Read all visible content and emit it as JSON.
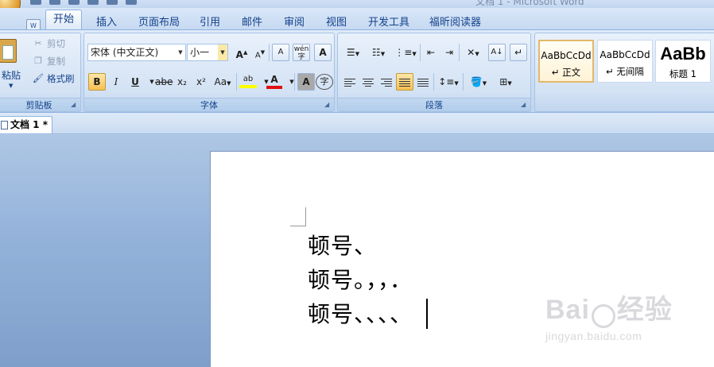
{
  "window": {
    "title": "文档 1 - Microsoft Word"
  },
  "tabs": [
    {
      "label": "开始",
      "active": true
    },
    {
      "label": "插入"
    },
    {
      "label": "页面布局"
    },
    {
      "label": "引用"
    },
    {
      "label": "邮件"
    },
    {
      "label": "审阅"
    },
    {
      "label": "视图"
    },
    {
      "label": "开发工具"
    },
    {
      "label": "福昕阅读器"
    }
  ],
  "clipboard": {
    "paste": "粘贴",
    "cut": "剪切",
    "copy": "复制",
    "format_painter": "格式刷",
    "group_label": "剪贴板"
  },
  "font": {
    "name": "宋体 (中文正文)",
    "size": "小一",
    "grow_label": "A",
    "shrink_label": "A",
    "bold": "B",
    "italic": "I",
    "underline": "U",
    "strike": "abe",
    "subscript": "x₂",
    "superscript": "x²",
    "change_case": "Aa",
    "clear_format": "A",
    "phonetic": "wén",
    "char_border": "A",
    "font_color": "A",
    "char_shading": "A",
    "enclose": "字",
    "highlight_color": "#ffff00",
    "font_color_value": "#e01010",
    "group_label": "字体"
  },
  "paragraph": {
    "group_label": "段落",
    "align_justify_active": true
  },
  "styles": [
    {
      "preview": "AaBbCcDd",
      "name": "↵ 正文",
      "selected": true
    },
    {
      "preview": "AaBbCcDd",
      "name": "↵ 无间隔"
    },
    {
      "preview": "AaBb",
      "name": "标题 1"
    }
  ],
  "document": {
    "tab_label": "文档 1 *",
    "lines": [
      "顿号、",
      "顿号。，，．",
      "顿号、、、、"
    ]
  },
  "watermark": {
    "brand": "Bai",
    "brand2": "经验",
    "url": "jingyan.baidu.com"
  }
}
